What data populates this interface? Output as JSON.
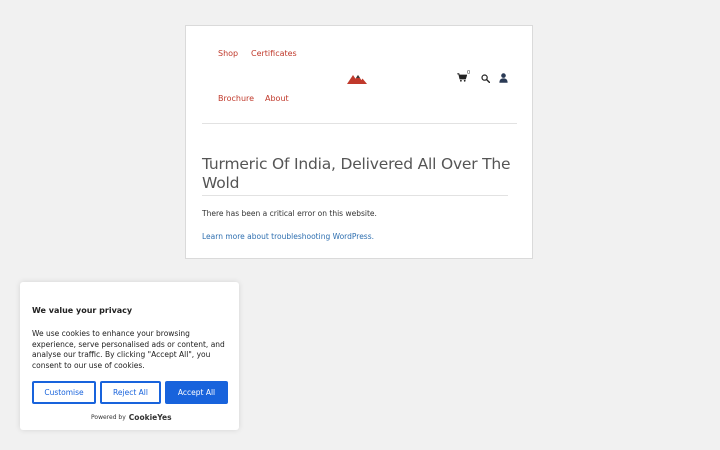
{
  "nav": {
    "items": [
      {
        "label": "Shop"
      },
      {
        "label": "Certificates"
      },
      {
        "label": "Brochure"
      },
      {
        "label": "About"
      }
    ],
    "cart_count": "0",
    "accent_color": "#c0392b"
  },
  "icons": {
    "logo": "mountain-logo",
    "cart": "cart-icon",
    "search": "search-icon",
    "account": "user-icon"
  },
  "main": {
    "title": "Turmeric Of India, Delivered All Over The Wold",
    "error_message": "There has been a critical error on this website.",
    "help_link": "Learn more about troubleshooting WordPress."
  },
  "cookie_banner": {
    "title": "We value your privacy",
    "description": "We use cookies to enhance your browsing experience, serve personalised ads or content, and analyse our traffic. By clicking \"Accept All\", you consent to our use of cookies.",
    "buttons": {
      "customise": "Customise",
      "reject": "Reject All",
      "accept": "Accept All"
    },
    "powered_by": "Powered by",
    "brand": "CookieYes",
    "brand_color": "#1863dc"
  }
}
